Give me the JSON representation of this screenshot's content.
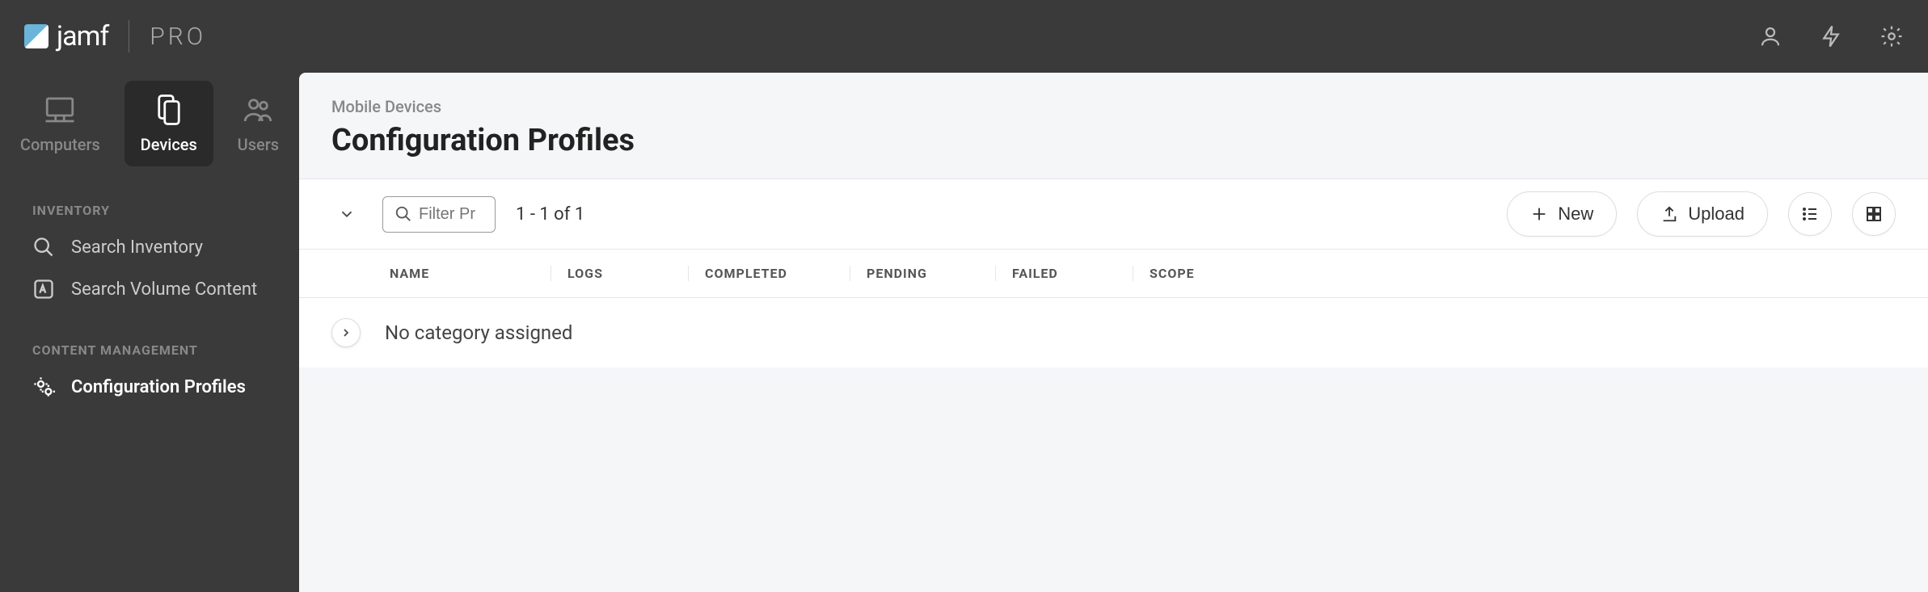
{
  "logo": {
    "text": "jamf",
    "suffix": "PRO"
  },
  "nav_tabs": [
    {
      "label": "Computers"
    },
    {
      "label": "Devices"
    },
    {
      "label": "Users"
    }
  ],
  "sidebar": {
    "section_inventory": "INVENTORY",
    "item_search_inventory": "Search Inventory",
    "item_search_volume": "Search Volume Content",
    "section_content": "CONTENT MANAGEMENT",
    "item_config_profiles": "Configuration Profiles"
  },
  "content": {
    "breadcrumb": "Mobile Devices",
    "title": "Configuration Profiles",
    "filter_placeholder": "Filter Pr",
    "result_count": "1 - 1 of 1",
    "btn_new": "New",
    "btn_upload": "Upload"
  },
  "table": {
    "col_name": "NAME",
    "col_logs": "LOGS",
    "col_completed": "COMPLETED",
    "col_pending": "PENDING",
    "col_failed": "FAILED",
    "col_scope": "SCOPE",
    "category_row": "No category assigned"
  }
}
